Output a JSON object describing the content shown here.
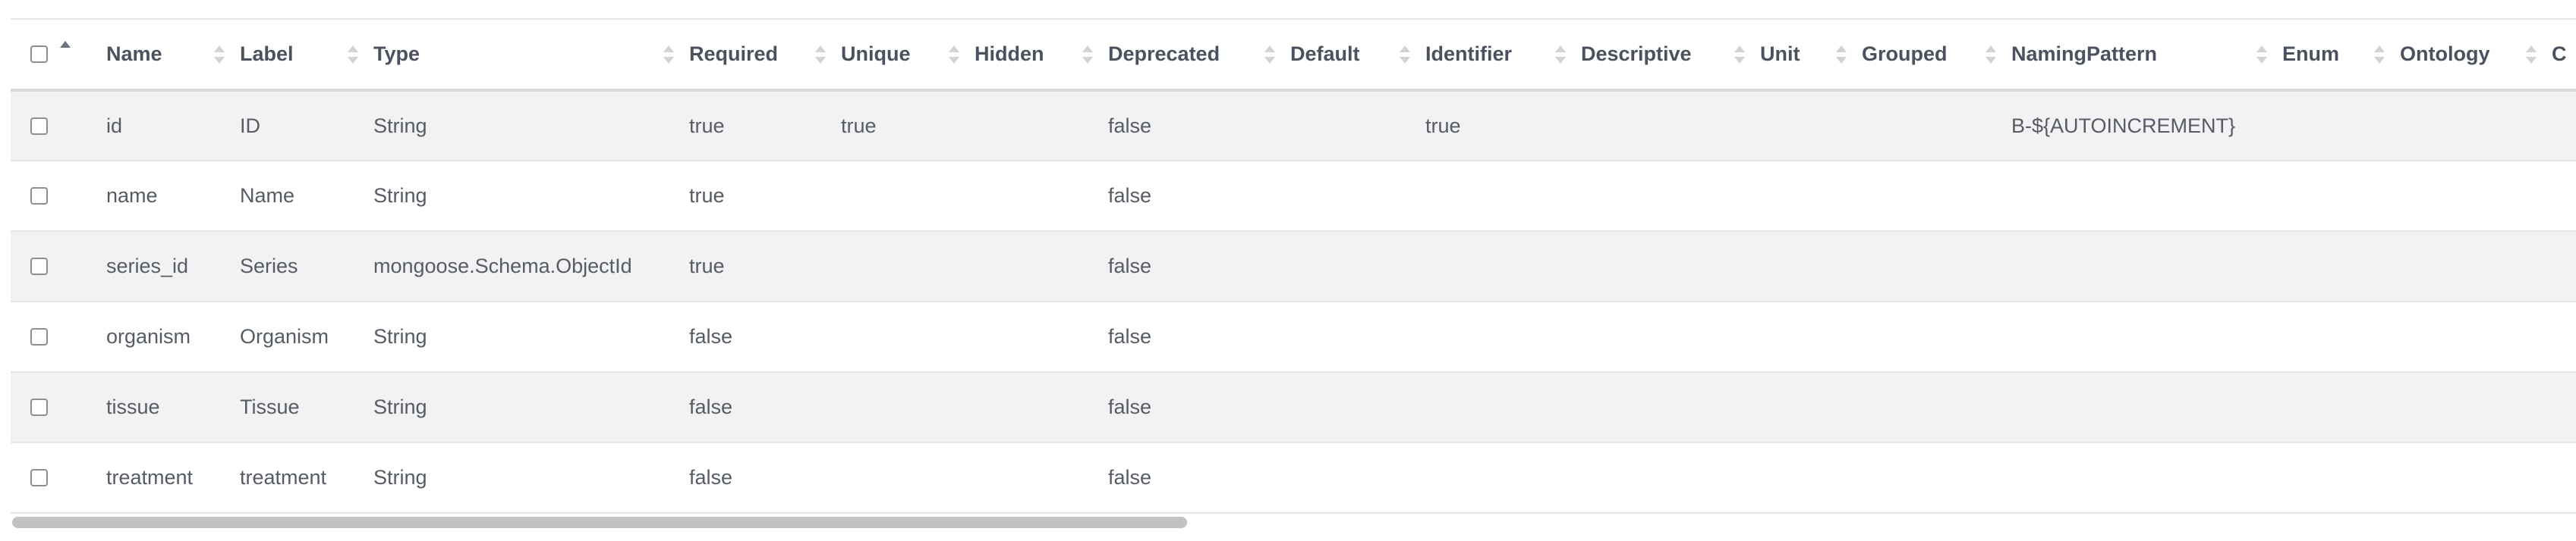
{
  "table": {
    "columns": [
      {
        "key": "select",
        "label": ""
      },
      {
        "key": "name",
        "label": "Name"
      },
      {
        "key": "label",
        "label": "Label"
      },
      {
        "key": "type",
        "label": "Type"
      },
      {
        "key": "required",
        "label": "Required"
      },
      {
        "key": "unique",
        "label": "Unique"
      },
      {
        "key": "hidden",
        "label": "Hidden"
      },
      {
        "key": "deprecated",
        "label": "Deprecated"
      },
      {
        "key": "default",
        "label": "Default"
      },
      {
        "key": "identifier",
        "label": "Identifier"
      },
      {
        "key": "descriptive",
        "label": "Descriptive"
      },
      {
        "key": "unit",
        "label": "Unit"
      },
      {
        "key": "grouped",
        "label": "Grouped"
      },
      {
        "key": "naming_pattern",
        "label": "NamingPattern"
      },
      {
        "key": "enum",
        "label": "Enum"
      },
      {
        "key": "ontology",
        "label": "Ontology"
      },
      {
        "key": "more",
        "label": "C"
      }
    ],
    "rows": [
      {
        "name": "id",
        "label": "ID",
        "type": "String",
        "required": "true",
        "unique": "true",
        "hidden": "",
        "deprecated": "false",
        "default": "",
        "identifier": "true",
        "descriptive": "",
        "unit": "",
        "grouped": "",
        "naming_pattern": "B-${AUTOINCREMENT}",
        "enum": "",
        "ontology": ""
      },
      {
        "name": "name",
        "label": "Name",
        "type": "String",
        "required": "true",
        "unique": "",
        "hidden": "",
        "deprecated": "false",
        "default": "",
        "identifier": "",
        "descriptive": "",
        "unit": "",
        "grouped": "",
        "naming_pattern": "",
        "enum": "",
        "ontology": ""
      },
      {
        "name": "series_id",
        "label": "Series",
        "type": "mongoose.Schema.ObjectId",
        "required": "true",
        "unique": "",
        "hidden": "",
        "deprecated": "false",
        "default": "",
        "identifier": "",
        "descriptive": "",
        "unit": "",
        "grouped": "",
        "naming_pattern": "",
        "enum": "",
        "ontology": ""
      },
      {
        "name": "organism",
        "label": "Organism",
        "type": "String",
        "required": "false",
        "unique": "",
        "hidden": "",
        "deprecated": "false",
        "default": "",
        "identifier": "",
        "descriptive": "",
        "unit": "",
        "grouped": "",
        "naming_pattern": "",
        "enum": "",
        "ontology": ""
      },
      {
        "name": "tissue",
        "label": "Tissue",
        "type": "String",
        "required": "false",
        "unique": "",
        "hidden": "",
        "deprecated": "false",
        "default": "",
        "identifier": "",
        "descriptive": "",
        "unit": "",
        "grouped": "",
        "naming_pattern": "",
        "enum": "",
        "ontology": ""
      },
      {
        "name": "treatment",
        "label": "treatment",
        "type": "String",
        "required": "false",
        "unique": "",
        "hidden": "",
        "deprecated": "false",
        "default": "",
        "identifier": "",
        "descriptive": "",
        "unit": "",
        "grouped": "",
        "naming_pattern": "",
        "enum": "",
        "ontology": ""
      }
    ]
  },
  "scrollbar": {
    "horizontal_position_fraction": 0.0,
    "visible_fraction": 0.46
  }
}
